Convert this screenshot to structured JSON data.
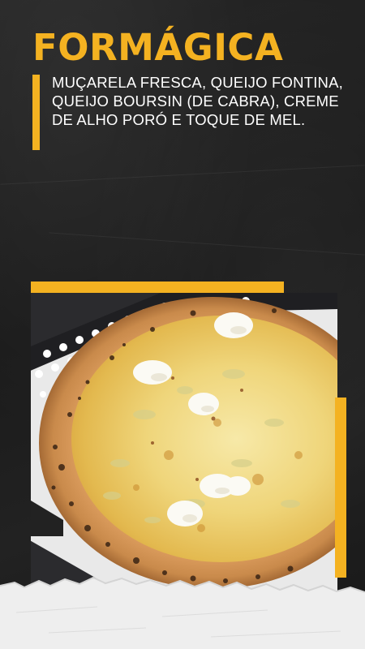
{
  "product": {
    "name": "FORMÁGICA",
    "description": "MUÇARELA FRESCA, QUEIJO FONTINA, QUEIJO BOURSIN (DE CABRA), CREME DE ALHO PORÓ E TOQUE DE MEL."
  },
  "colors": {
    "accent": "#f4b221",
    "background": "#1c1c1c",
    "text": "#ffffff",
    "paper": "#eeeeee"
  }
}
